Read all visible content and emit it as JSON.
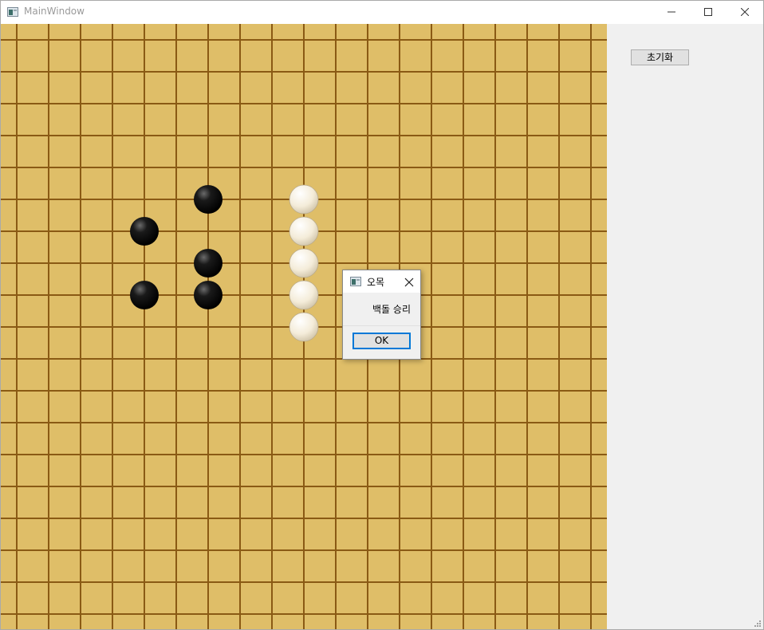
{
  "window": {
    "title": "MainWindow",
    "icon": "app-window-icon",
    "controls": [
      "minimize-icon",
      "maximize-icon",
      "close-icon"
    ]
  },
  "board": {
    "background_color": "#dfbe68",
    "grid_color": "#8a5a14",
    "grid_lines": 19,
    "stones": [
      {
        "color": "black",
        "col": 6,
        "row": 5
      },
      {
        "color": "black",
        "col": 4,
        "row": 6
      },
      {
        "color": "black",
        "col": 6,
        "row": 7
      },
      {
        "color": "black",
        "col": 4,
        "row": 8
      },
      {
        "color": "black",
        "col": 6,
        "row": 8
      },
      {
        "color": "white",
        "col": 9,
        "row": 5
      },
      {
        "color": "white",
        "col": 9,
        "row": 6
      },
      {
        "color": "white",
        "col": 9,
        "row": 7
      },
      {
        "color": "white",
        "col": 9,
        "row": 8
      },
      {
        "color": "white",
        "col": 9,
        "row": 9
      }
    ]
  },
  "side_panel": {
    "reset_label": "초기화"
  },
  "dialog": {
    "title": "오목",
    "message": "백돌 승리",
    "ok_label": "OK",
    "accent_color": "#0078d7"
  }
}
